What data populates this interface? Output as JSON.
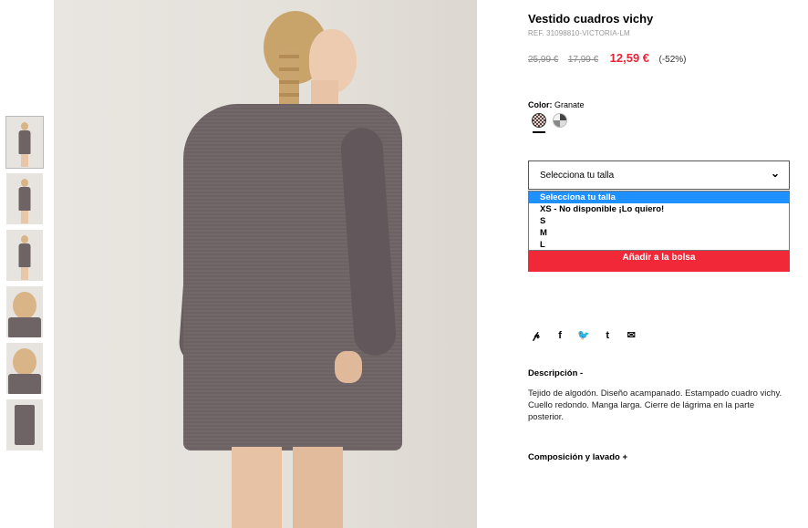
{
  "product": {
    "title": "Vestido cuadros vichy",
    "ref": "REF. 31098810-VICTORIA-LM",
    "prices": {
      "original": "25,99 €",
      "previous": "17,99 €",
      "current": "12,59 €",
      "discount": "(-52%)"
    },
    "color_label": "Color:",
    "color_value": "Granate",
    "color_swatches": [
      "granate-vichy-swatch",
      "gris-swatch"
    ]
  },
  "size_select": {
    "value": "Selecciona tu talla",
    "options": [
      "Selecciona tu talla",
      "XS - No disponible ¡Lo quiero!",
      "S",
      "M",
      "L"
    ]
  },
  "actions": {
    "add_to_bag": "Añadir a la bolsa"
  },
  "share_icons": [
    "pinterest-icon",
    "facebook-icon",
    "twitter-icon",
    "tumblr-icon",
    "email-icon"
  ],
  "share_glyphs": {
    "pinterest": "𝓅",
    "facebook": "f",
    "twitter": "🐦",
    "tumblr": "t",
    "email": "✉"
  },
  "description": {
    "heading": "Descripción -",
    "text": "Tejido de algodón. Diseño acampanado. Estampado cuadro vichy. Cuello redondo. Manga larga. Cierre de lágrima en la parte posterior."
  },
  "composition": {
    "heading": "Composición y lavado +"
  },
  "colors": {
    "price_red": "#e72537",
    "button_red": "#f02838",
    "option_highlight": "#1e90ff"
  },
  "gallery": {
    "thumbnail_count": 6,
    "selected_index": 0
  }
}
